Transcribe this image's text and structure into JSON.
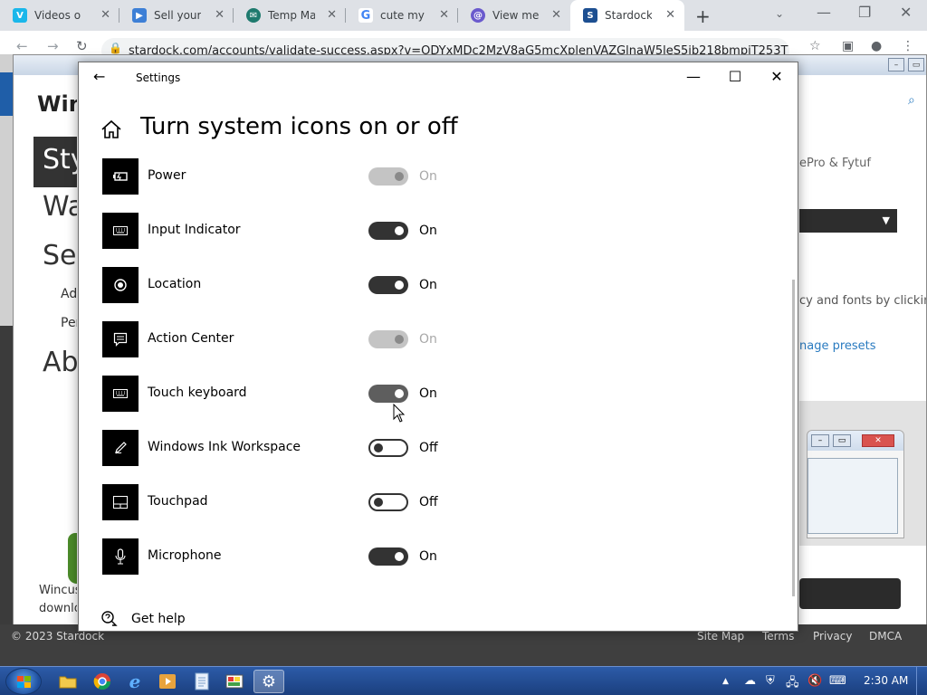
{
  "browser": {
    "tabs": [
      {
        "title": "Videos on V",
        "icon": "vimeo-icon",
        "color": "#1ab7ea",
        "glyph": "V"
      },
      {
        "title": "Sell your vi",
        "icon": "shield-play-icon",
        "color": "#3d7fd6",
        "glyph": "▶"
      },
      {
        "title": "Temp Mail",
        "icon": "tempmail-icon",
        "color": "#1e7a6e",
        "glyph": "✉"
      },
      {
        "title": "cute my litt",
        "icon": "google-icon",
        "color": "#ffffff",
        "glyph": "G"
      },
      {
        "title": "View messa",
        "icon": "at-sign-icon",
        "color": "#6a5acd",
        "glyph": "@"
      },
      {
        "title": "Stardock A",
        "icon": "stardock-icon",
        "color": "#1d4f91",
        "glyph": "S"
      }
    ],
    "active_tab": 5,
    "url": "stardock.com/accounts/validate-success.aspx?v=ODYxMDc2MzV8aG5mcXplenVAZGlnaW5leS5ib218bmpiT253T"
  },
  "webpage": {
    "brand": "Win",
    "nav_style": "Sty",
    "nav_wa": "Wa",
    "nav_set": "Set",
    "sub_ad": "Ad",
    "sub_per": "Per",
    "nav_ab": "Ab",
    "desc_1": "Wincus",
    "desc_2": "downlo",
    "authors": "ePro & Fytuf",
    "hint": "cy and fonts by clicking",
    "presets_link": "nage presets",
    "footer": {
      "copyright": "© 2023 Stardock",
      "links": [
        "Site Map",
        "Terms",
        "Privacy",
        "DMCA"
      ]
    }
  },
  "settings": {
    "window_title": "Settings",
    "heading": "Turn system icons on or off",
    "items": [
      {
        "label": "Power",
        "state": "On",
        "toggle": "dis",
        "icon": "battery-icon"
      },
      {
        "label": "Input Indicator",
        "state": "On",
        "toggle": "on",
        "icon": "keyboard-icon"
      },
      {
        "label": "Location",
        "state": "On",
        "toggle": "on",
        "icon": "location-icon"
      },
      {
        "label": "Action Center",
        "state": "On",
        "toggle": "dis",
        "icon": "action-center-icon"
      },
      {
        "label": "Touch keyboard",
        "state": "On",
        "toggle": "hov",
        "icon": "touch-keyboard-icon"
      },
      {
        "label": "Windows Ink Workspace",
        "state": "Off",
        "toggle": "off",
        "icon": "pen-icon"
      },
      {
        "label": "Touchpad",
        "state": "Off",
        "toggle": "off",
        "icon": "touchpad-icon"
      },
      {
        "label": "Microphone",
        "state": "On",
        "toggle": "on",
        "icon": "microphone-icon"
      }
    ],
    "help_label": "Get help"
  },
  "taskbar": {
    "clock": "2:30 AM",
    "pinned": [
      "explorer-icon",
      "chrome-icon",
      "ie-icon",
      "media-player-icon",
      "notepad-icon",
      "paint-icon",
      "settings-gear-icon"
    ]
  },
  "colors": {
    "toggle_on": "#333333",
    "toggle_disabled": "#c4c4c4",
    "taskbar": "#1b3f7e",
    "link": "#2a7bc0"
  }
}
